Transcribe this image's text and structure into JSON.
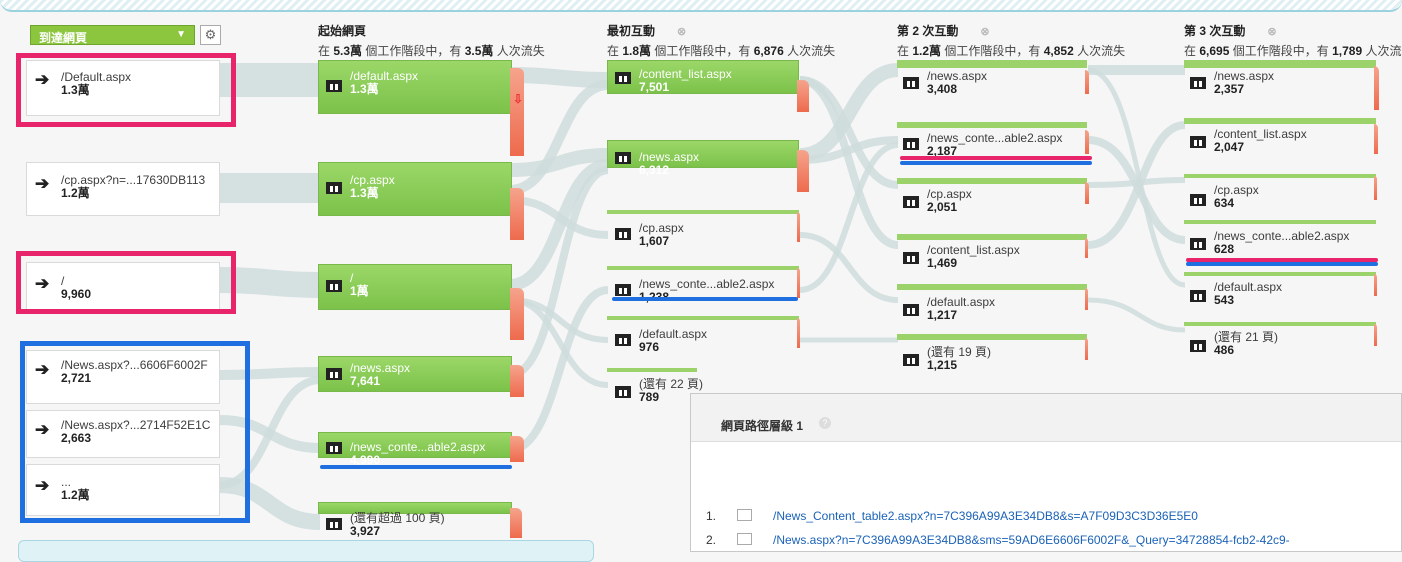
{
  "toolbar": {
    "dimension": "到達網頁"
  },
  "columns": [
    {
      "title": "起始網頁",
      "sub_prefix": "在",
      "sessions": "5.3萬",
      "sub_mid": "個工作階段中，有",
      "drops": "3.5萬",
      "sub_suffix": "人次流失"
    },
    {
      "title": "最初互動",
      "sub_prefix": "在",
      "sessions": "1.8萬",
      "sub_mid": "個工作階段中，有",
      "drops": "6,876",
      "sub_suffix": "人次流失"
    },
    {
      "title": "第 2 次互動",
      "sub_prefix": "在",
      "sessions": "1.2萬",
      "sub_mid": "個工作階段中，有",
      "drops": "4,852",
      "sub_suffix": "人次流失"
    },
    {
      "title": "第 3 次互動",
      "sub_prefix": "在",
      "sessions": "6,695",
      "sub_mid": "個工作階段中，有",
      "drops": "1,789",
      "sub_suffix": "人次流"
    }
  ],
  "sources": [
    {
      "name": "/Default.aspx",
      "value": "1.3萬"
    },
    {
      "name": "/cp.aspx?n=...17630DB113",
      "value": "1.2萬"
    },
    {
      "name": "/",
      "value": "9,960"
    },
    {
      "name": "/News.aspx?...6606F6002F",
      "value": "2,721"
    },
    {
      "name": "/News.aspx?...2714F52E1C",
      "value": "2,663"
    },
    {
      "name": "...",
      "value": "1.2萬"
    }
  ],
  "start_pages": [
    {
      "name": "/default.aspx",
      "value": "1.3萬"
    },
    {
      "name": "/cp.aspx",
      "value": "1.3萬"
    },
    {
      "name": "/",
      "value": "1萬"
    },
    {
      "name": "/news.aspx",
      "value": "7,641"
    },
    {
      "name": "/news_conte...able2.aspx",
      "value": "4,990"
    },
    {
      "name": "(還有超過 100 頁)",
      "value": "3,927"
    }
  ],
  "first_interaction": [
    {
      "name": "/content_list.aspx",
      "value": "7,501"
    },
    {
      "name": "/news.aspx",
      "value": "6,312"
    },
    {
      "name": "/cp.aspx",
      "value": "1,607"
    },
    {
      "name": "/news_conte...able2.aspx",
      "value": "1,238"
    },
    {
      "name": "/default.aspx",
      "value": "976"
    },
    {
      "name": "(還有 22 頁)",
      "value": "789"
    }
  ],
  "second_interaction": [
    {
      "name": "/news.aspx",
      "value": "3,408"
    },
    {
      "name": "/news_conte...able2.aspx",
      "value": "2,187"
    },
    {
      "name": "/cp.aspx",
      "value": "2,051"
    },
    {
      "name": "/content_list.aspx",
      "value": "1,469"
    },
    {
      "name": "/default.aspx",
      "value": "1,217"
    },
    {
      "name": "(還有 19 頁)",
      "value": "1,215"
    }
  ],
  "third_interaction": [
    {
      "name": "/news.aspx",
      "value": "2,357"
    },
    {
      "name": "/content_list.aspx",
      "value": "2,047"
    },
    {
      "name": "/cp.aspx",
      "value": "634"
    },
    {
      "name": "/news_conte...able2.aspx",
      "value": "628"
    },
    {
      "name": "/default.aspx",
      "value": "543"
    },
    {
      "name": "(還有 21 頁)",
      "value": "486"
    }
  ],
  "panel": {
    "title": "網頁路徑層級 1",
    "help": "?",
    "rows": [
      {
        "num": "1.",
        "url": "/News_Content_table2.aspx?n=7C396A99A3E34DB8&s=A7F09D3C3D36E5E0"
      },
      {
        "num": "2.",
        "url": "/News.aspx?n=7C396A99A3E34DB8&sms=59AD6E6606F6002F&_Query=34728854-fcb2-42c9-"
      }
    ]
  },
  "colors": {
    "accent_green": "#8cc63f",
    "highlight_pink": "#e8246b",
    "highlight_blue": "#1f6fe0",
    "dropoff": "#ee6a4d"
  }
}
